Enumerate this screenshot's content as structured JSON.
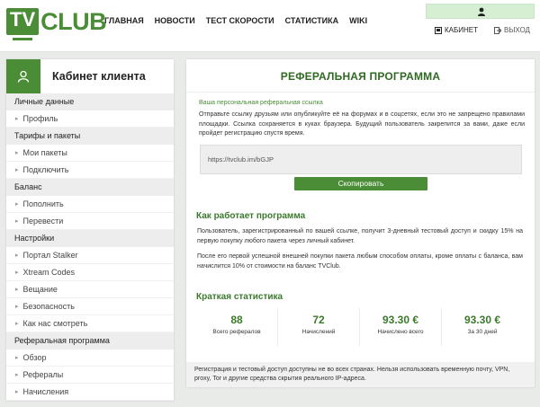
{
  "colors": {
    "brand": "#4a8d36",
    "heading": "#3b7a2c",
    "user_box": "#d6efd3"
  },
  "logo": {
    "part1": "TV",
    "part2": "CLUB"
  },
  "nav": [
    "ГЛАВНАЯ",
    "НОВОСТИ",
    "ТЕСТ СКОРОСТИ",
    "СТАТИСТИКА",
    "WIKI"
  ],
  "header": {
    "cabinet": "КАБИНЕТ",
    "logout": "ВЫХОД"
  },
  "sidebar": {
    "title": "Кабинет клиента",
    "sections": [
      {
        "title": "Личные данные",
        "items": [
          "Профиль"
        ]
      },
      {
        "title": "Тарифы и пакеты",
        "items": [
          "Мои пакеты",
          "Подключить"
        ]
      },
      {
        "title": "Баланс",
        "items": [
          "Пополнить",
          "Перевести"
        ]
      },
      {
        "title": "Настройки",
        "items": [
          "Портал Stalker",
          "Xtream Codes",
          "Вещание",
          "Безопасность",
          "Как нас смотреть"
        ]
      },
      {
        "title": "Реферальная программа",
        "items": [
          "Обзор",
          "Рефералы",
          "Начисления"
        ]
      }
    ]
  },
  "main": {
    "title": "РЕФЕРАЛЬНАЯ ПРОГРАММА",
    "ref_label": "Ваша персональная реферальная ссылка",
    "ref_desc": "Отправьте ссылку друзьям или опубликуйте её на форумах и в соцсетях, если это не запрещено правилами площадки. Ссылка сохраняется в куках браузера. Будущий пользователь закрепится за вами, даже если пройдет регистрацию спустя время.",
    "ref_link": "https://tvclub.im/bGJP",
    "copy_button": "Скопировать",
    "how_title": "Как работает программа",
    "how_p1": "Пользователь, зарегистрированный по вашей ссылке, получит 3-дневный тестовый доступ и скидку 15% на первую покупку любого пакета через личный кабинет.",
    "how_p2": "После его первой успешной внешней покупки пакета любым способом оплаты, кроме оплаты с баланса, вам начислится 10% от стоимости на баланс TVClub.",
    "stats_title": "Краткая статистика",
    "stats": [
      {
        "value": "88",
        "label": "Всего рефералов"
      },
      {
        "value": "72",
        "label": "Начислений"
      },
      {
        "value": "93.30 €",
        "label": "Начислено всего"
      },
      {
        "value": "93.30 €",
        "label": "За 30 дней"
      }
    ],
    "footer_note": "Регистрация и тестовый доступ доступны не во всех странах. Нельзя использовать временную почту, VPN, proxy, Tor и другие средства скрытия реального IP-адреса."
  }
}
